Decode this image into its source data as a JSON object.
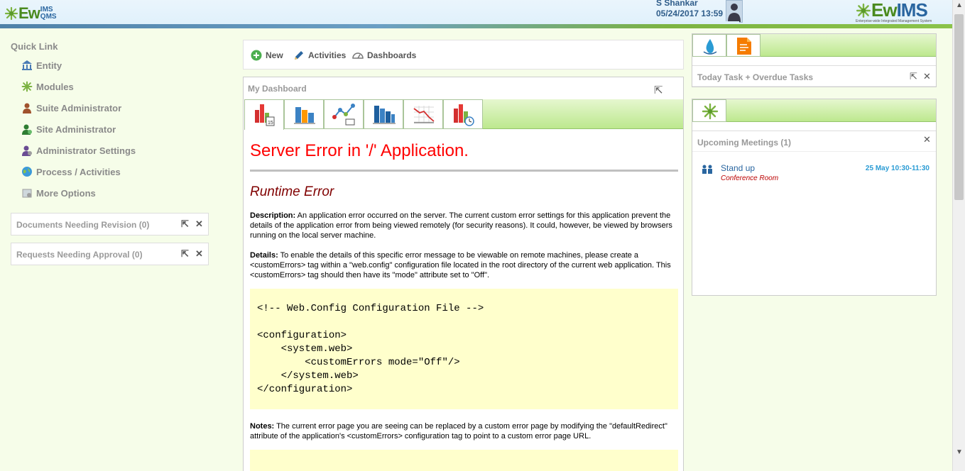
{
  "header": {
    "logo_left": {
      "ew": "Ew",
      "ims": "IMS",
      "qms": "QMS"
    },
    "user_name": "S Shankar",
    "user_date": "05/24/2017 13:59",
    "logo_right": {
      "ew": "Ew",
      "ims": "IMS",
      "tagline": "Enterprise-wide Integrated Management System"
    }
  },
  "sidebar": {
    "title": "Quick Link",
    "items": [
      {
        "label": "Entity",
        "icon": "building-icon",
        "color": "#4a7bb5"
      },
      {
        "label": "Modules",
        "icon": "modules-icon",
        "color": "#7cb342"
      },
      {
        "label": "Suite Administrator",
        "icon": "user-admin-icon",
        "color": "#a0522d"
      },
      {
        "label": "Site Administrator",
        "icon": "user-site-icon",
        "color": "#2e7d32"
      },
      {
        "label": "Administrator Settings",
        "icon": "user-settings-icon",
        "color": "#6a4c93"
      },
      {
        "label": "Process / Activities",
        "icon": "globe-icon",
        "color": "#3b9ad9"
      },
      {
        "label": "More Options",
        "icon": "more-options-icon",
        "color": "#9e9e9e"
      }
    ],
    "widgets": [
      {
        "label": "Documents Needing Revision (0)"
      },
      {
        "label": "Requests Needing Approval (0)"
      }
    ]
  },
  "toolbar": {
    "new_label": "New",
    "activities_label": "Activities",
    "dashboards_label": "Dashboards"
  },
  "dashboard": {
    "title": "My Dashboard",
    "tabs": [
      {
        "icon": "calendar-bar-chart-icon"
      },
      {
        "icon": "bar-chart-icon"
      },
      {
        "icon": "network-chart-icon"
      },
      {
        "icon": "bar-chart-blue-icon"
      },
      {
        "icon": "line-chart-icon"
      },
      {
        "icon": "timer-bar-chart-icon"
      }
    ],
    "error": {
      "h1": "Server Error in '/' Application.",
      "h2": "Runtime Error",
      "description_label": "Description:",
      "description_text": " An application error occurred on the server. The current custom error settings for this application prevent the details of the application error from being viewed remotely (for security reasons). It could, however, be viewed by browsers running on the local server machine.",
      "details_label": "Details:",
      "details_text": " To enable the details of this specific error message to be viewable on remote machines, please create a <customErrors> tag within a \"web.config\" configuration file located in the root directory of the current web application. This <customErrors> tag should then have its \"mode\" attribute set to \"Off\".",
      "code": "\n<!-- Web.Config Configuration File -->\n\n<configuration>\n    <system.web>\n        <customErrors mode=\"Off\"/>\n    </system.web>\n</configuration>",
      "notes_label": "Notes:",
      "notes_text": " The current error page you are seeing can be replaced by a custom error page by modifying the \"defaultRedirect\" attribute of the application's <customErrors> configuration tag to point to a custom error page URL."
    }
  },
  "right": {
    "tasks_title": "Today Task + Overdue Tasks",
    "meetings_title": "Upcoming Meetings (1)",
    "meeting": {
      "title": "Stand up",
      "room": "Conference Room",
      "time": "25 May 10:30-11:30"
    }
  }
}
